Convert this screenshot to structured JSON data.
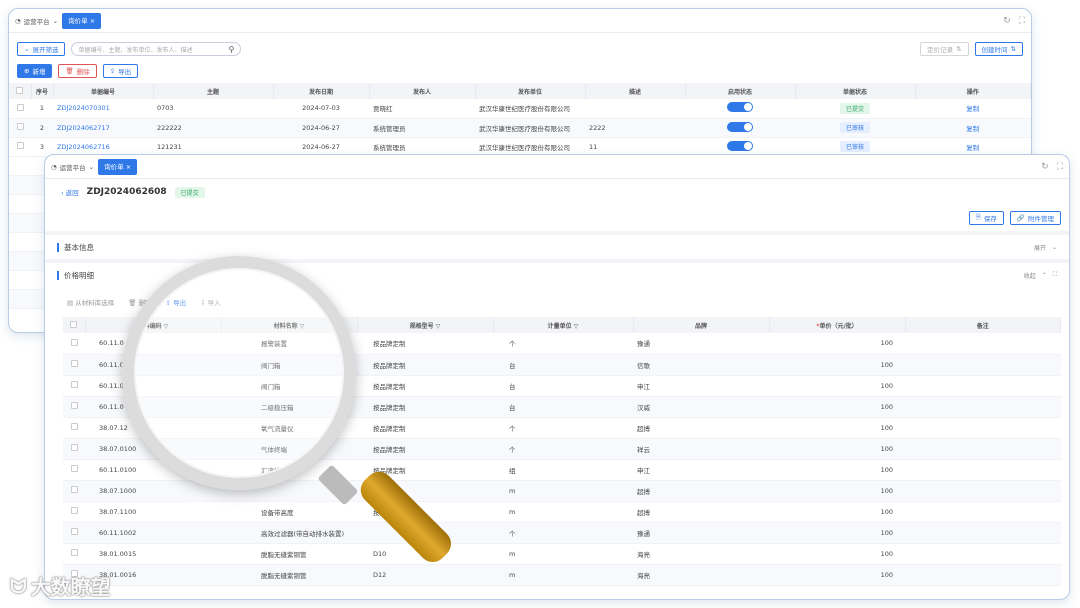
{
  "back_window": {
    "platform_tab": "运营平台",
    "active_tab": "询价单",
    "filter_button": "展开筛选",
    "search_placeholder": "单据编号、主题、发布单位、发布人、描述",
    "right_buttons": [
      "定价记录",
      "创建时间"
    ],
    "action_buttons": {
      "add": "新增",
      "delete": "删除",
      "export": "导出"
    },
    "columns": [
      "序号",
      "单据编号",
      "主题",
      "发布日期",
      "发布人",
      "发布单位",
      "描述",
      "启用状态",
      "单据状态",
      "操作"
    ],
    "rows": [
      {
        "no": "1",
        "code": "ZDJ2024070301",
        "subject": "0703",
        "date": "2024-07-03",
        "publisher": "贾晓红",
        "unit": "武汉华康世纪医疗股份有限公司",
        "desc": "",
        "status": "已提交",
        "op": "复制"
      },
      {
        "no": "2",
        "code": "ZDJ2024062717",
        "subject": "222222",
        "date": "2024-06-27",
        "publisher": "系统管理员",
        "unit": "武汉华康世纪医疗股份有限公司",
        "desc": "2222",
        "status": "已审核",
        "op": "复制"
      },
      {
        "no": "3",
        "code": "ZDJ2024062716",
        "subject": "121231",
        "date": "2024-06-27",
        "publisher": "系统管理员",
        "unit": "武汉华康世纪医疗股份有限公司",
        "desc": "11",
        "status": "已审核",
        "op": "复制"
      }
    ]
  },
  "front_window": {
    "platform_tab": "运营平台",
    "active_tab": "询价单",
    "back_label": "返回",
    "doc_code": "ZDJ2024062608",
    "doc_status": "已提交",
    "action_buttons": {
      "save": "保存",
      "attachments": "附件管理"
    },
    "section_basic": "基本信息",
    "section_basic_toggle": "展开",
    "section_price": "价格明细",
    "section_price_toggle": "收起",
    "toolbar": {
      "from_library": "从材料库选择",
      "delete": "删除",
      "export": "导出",
      "import": "导入"
    },
    "columns": [
      "材料编码",
      "材料名称",
      "规格型号",
      "计量单位",
      "品牌",
      "单价（元/批）",
      "备注"
    ],
    "required_mark": "*",
    "rows": [
      {
        "code": "60.11.0",
        "name": "报警装置",
        "spec": "按品牌定制",
        "unit": "个",
        "brand": "豫通",
        "price": "100"
      },
      {
        "code": "60.11.0",
        "name": "阀门箱",
        "spec": "按品牌定制",
        "unit": "台",
        "brand": "信歌",
        "price": "100"
      },
      {
        "code": "60.11.0",
        "name": "阀门箱",
        "spec": "按品牌定制",
        "unit": "台",
        "brand": "申江",
        "price": "100"
      },
      {
        "code": "60.11.0",
        "name": "二级稳压箱",
        "spec": "按品牌定制",
        "unit": "台",
        "brand": "汉威",
        "price": "100"
      },
      {
        "code": "38.07.12",
        "name": "氧气流量仪",
        "spec": "按品牌定制",
        "unit": "个",
        "brand": "超搏",
        "price": "100"
      },
      {
        "code": "38.07.0100",
        "name": "气体终端",
        "spec": "按品牌定制",
        "unit": "个",
        "brand": "祥云",
        "price": "100"
      },
      {
        "code": "60.11.0100",
        "name": "汇流排",
        "spec": "按品牌定制",
        "unit": "组",
        "brand": "申江",
        "price": "100"
      },
      {
        "code": "38.07.1000",
        "name": "",
        "spec": "",
        "unit": "m",
        "brand": "超搏",
        "price": "100"
      },
      {
        "code": "38.07.1100",
        "name": "设备带高度",
        "spec": "按品牌定制",
        "unit": "m",
        "brand": "超搏",
        "price": "100"
      },
      {
        "code": "60.11.1002",
        "name": "高效过滤器(带自动排水装置)",
        "spec": "",
        "unit": "个",
        "brand": "豫通",
        "price": "100"
      },
      {
        "code": "38.01.0015",
        "name": "脱脂无缝紫铜管",
        "spec": "D10",
        "unit": "m",
        "brand": "海亮",
        "price": "100"
      },
      {
        "code": "38.01.0016",
        "name": "脱脂无缝紫铜管",
        "spec": "D12",
        "unit": "m",
        "brand": "海亮",
        "price": "100"
      }
    ]
  },
  "watermark": "大数瞭望"
}
